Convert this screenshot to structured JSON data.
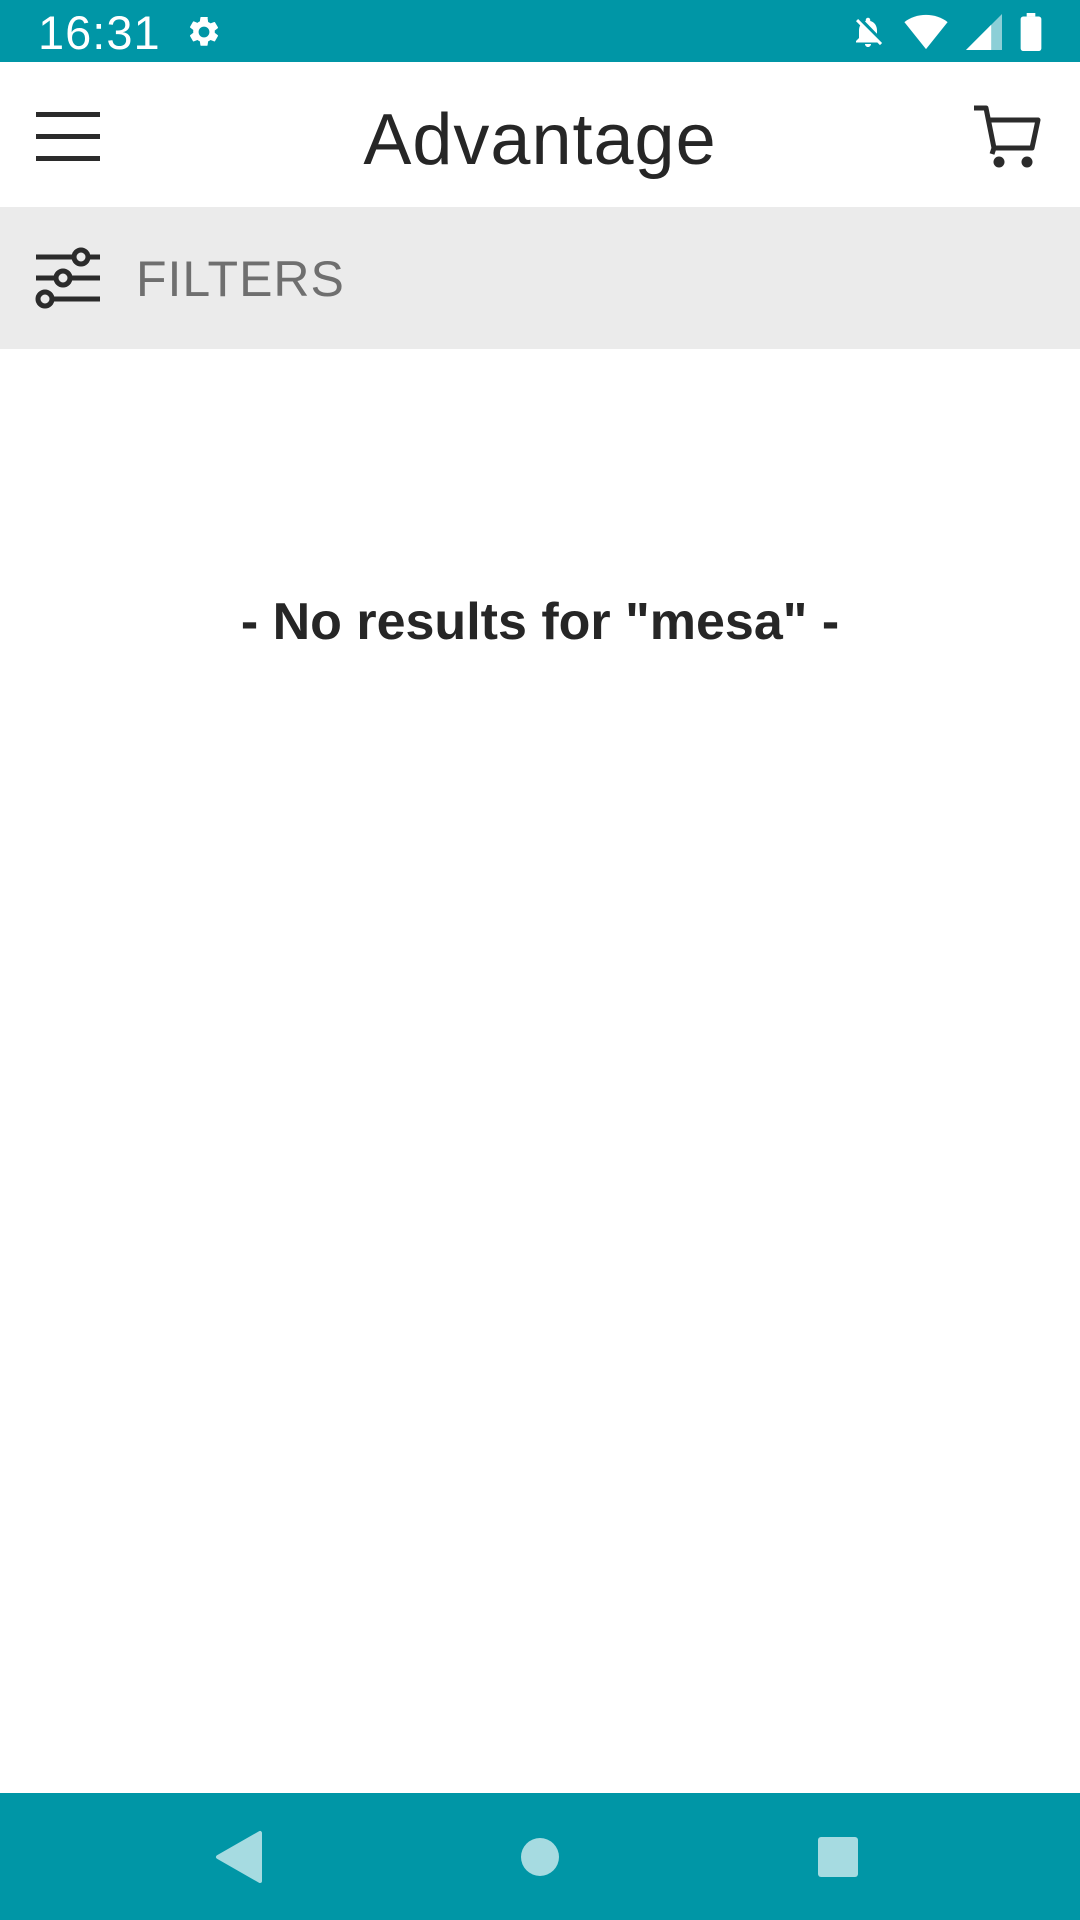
{
  "status_bar": {
    "time": "16:31",
    "background": "#0096a6",
    "icons": [
      "settings-gear-icon",
      "notifications-off-icon",
      "wifi-icon",
      "signal-icon",
      "battery-icon"
    ]
  },
  "app_bar": {
    "title": "Advantage",
    "menu_icon": "hamburger-menu-icon",
    "cart_icon": "shopping-cart-icon"
  },
  "filters": {
    "label": "FILTERS",
    "icon": "sliders-icon",
    "background": "#ebebeb"
  },
  "content": {
    "message": "- No results for \"mesa\" -"
  },
  "nav_bar": {
    "background": "#0096a6",
    "buttons": [
      "back-icon",
      "home-icon",
      "recents-icon"
    ]
  }
}
